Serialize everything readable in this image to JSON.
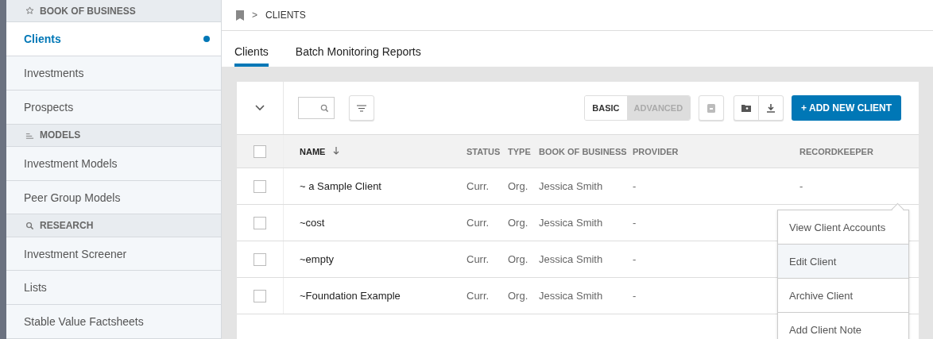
{
  "sidebar": {
    "sections": [
      {
        "title": "BOOK OF BUSINESS",
        "items": [
          {
            "label": "Clients",
            "selected": true
          },
          {
            "label": "Investments",
            "selected": false
          },
          {
            "label": "Prospects",
            "selected": false
          }
        ]
      },
      {
        "title": "MODELS",
        "items": [
          {
            "label": "Investment Models",
            "selected": false
          },
          {
            "label": "Peer Group Models",
            "selected": false
          }
        ]
      },
      {
        "title": "RESEARCH",
        "items": [
          {
            "label": "Investment Screener",
            "selected": false
          },
          {
            "label": "Lists",
            "selected": false
          },
          {
            "label": "Stable Value Factsheets",
            "selected": false
          }
        ]
      }
    ]
  },
  "breadcrumb": {
    "separator": ">",
    "current": "CLIENTS"
  },
  "tabs": [
    {
      "label": "Clients",
      "selected": true
    },
    {
      "label": "Batch Monitoring Reports",
      "selected": false
    }
  ],
  "toolbar": {
    "view_toggle": [
      {
        "label": "BASIC",
        "selected": true
      },
      {
        "label": "ADVANCED",
        "selected": false
      }
    ],
    "add_button": "+ ADD NEW CLIENT"
  },
  "table": {
    "select_all_checked": false,
    "columns": [
      {
        "label": "NAME",
        "sorted": true
      },
      {
        "label": "STATUS",
        "sorted": false
      },
      {
        "label": "TYPE",
        "sorted": false
      },
      {
        "label": "BOOK OF BUSINESS",
        "sorted": false
      },
      {
        "label": "PROVIDER",
        "sorted": false
      },
      {
        "label": "RECORDKEEPER",
        "sorted": false
      }
    ],
    "rows": [
      {
        "checked": false,
        "cells": [
          "~ a Sample Client",
          "Curr.",
          "Org.",
          "Jessica Smith",
          "-",
          "-"
        ]
      },
      {
        "checked": false,
        "cells": [
          "~cost",
          "Curr.",
          "Org.",
          "Jessica Smith",
          "-",
          ""
        ]
      },
      {
        "checked": false,
        "cells": [
          "~empty",
          "Curr.",
          "Org.",
          "Jessica Smith",
          "-",
          ""
        ]
      },
      {
        "checked": false,
        "cells": [
          "~Foundation Example",
          "Curr.",
          "Org.",
          "Jessica Smith",
          "-",
          ""
        ]
      }
    ]
  },
  "context_menu": {
    "items": [
      {
        "label": "View Client Accounts",
        "selected": false
      },
      {
        "label": "Edit Client",
        "selected": true
      },
      {
        "label": "Archive Client",
        "selected": false
      },
      {
        "label": "Add Client Note",
        "selected": false
      }
    ]
  }
}
